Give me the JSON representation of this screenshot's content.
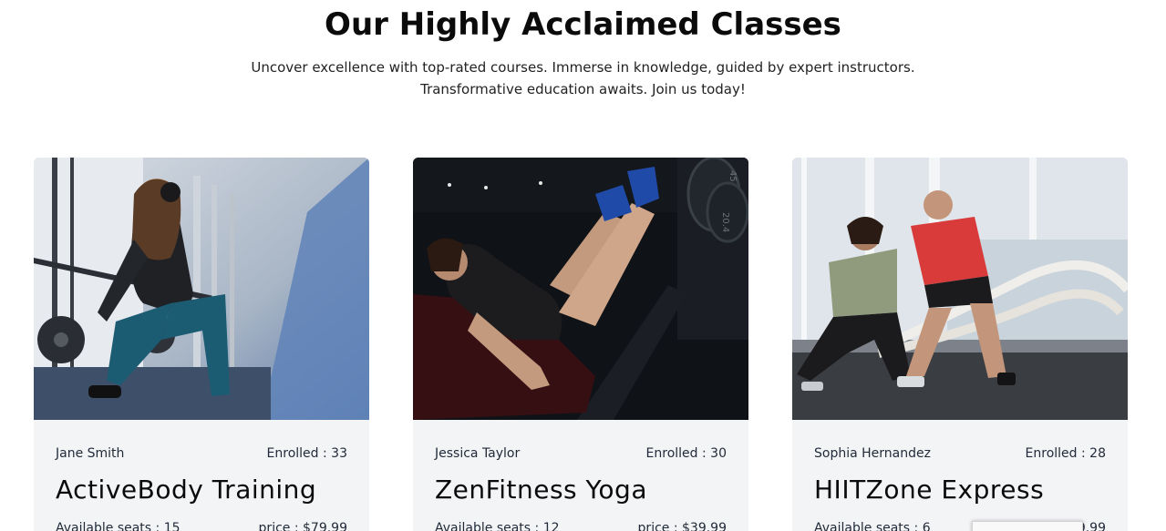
{
  "section": {
    "title": "Our Highly Acclaimed Classes",
    "subtitle_line1": "Uncover excellence with top-rated courses. Immerse in knowledge, guided by expert instructors.",
    "subtitle_line2": "Transformative education awaits. Join us today!"
  },
  "classes": [
    {
      "instructor": "Jane Smith",
      "enrolled": "Enrolled : 33",
      "title": "ActiveBody Training",
      "seats": "Available seats : 15",
      "price": "price : $79.99"
    },
    {
      "instructor": "Jessica Taylor",
      "enrolled": "Enrolled : 30",
      "title": "ZenFitness Yoga",
      "seats": "Available seats : 12",
      "price": "price : $39.99"
    },
    {
      "instructor": "Sophia Hernandez",
      "enrolled": "Enrolled : 28",
      "title": "HIITZone Express",
      "seats": "Available seats : 6",
      "price": "price : $39.99"
    }
  ],
  "colors": {
    "card_background": "#f3f4f6",
    "heading": "#0b0b0b",
    "body_text": "#1f2937"
  }
}
